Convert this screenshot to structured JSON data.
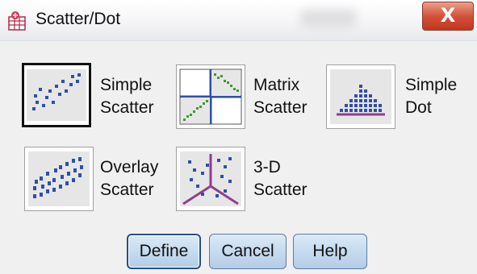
{
  "window": {
    "title": "Scatter/Dot",
    "close_glyph": "X"
  },
  "charts": [
    {
      "line1": "Simple",
      "line2": "Scatter",
      "icon": "simple-scatter-icon",
      "selected": true
    },
    {
      "line1": "Matrix",
      "line2": "Scatter",
      "icon": "matrix-scatter-icon",
      "selected": false
    },
    {
      "line1": "Simple",
      "line2": "Dot",
      "icon": "simple-dot-icon",
      "selected": false
    },
    {
      "line1": "Overlay",
      "line2": "Scatter",
      "icon": "overlay-scatter-icon",
      "selected": false
    },
    {
      "line1": "3-D",
      "line2": "Scatter",
      "icon": "3d-scatter-icon",
      "selected": false
    }
  ],
  "buttons": {
    "define": "Define",
    "cancel": "Cancel",
    "help": "Help"
  },
  "colors": {
    "icon_blue": "#2f4fa8",
    "icon_green": "#3a9b2a",
    "icon_purple": "#8e3f8f",
    "close_red": "#c9452d",
    "button_blue": "#c6dbef"
  }
}
